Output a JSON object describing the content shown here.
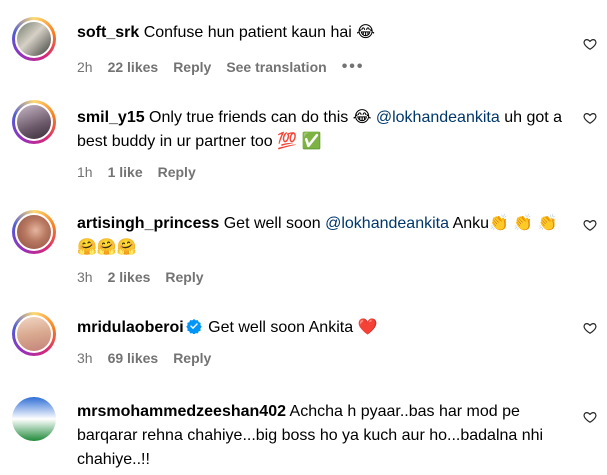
{
  "comments": [
    {
      "username": "soft_srk",
      "text": " Confuse hun patient kaun hai 😂",
      "time": "2h",
      "likes": "22 likes",
      "reply": "Reply",
      "translation": "See translation",
      "more": "•••"
    },
    {
      "username": "smil_y15",
      "text": " Only true friends can do this 😂 ",
      "mention": "@lokhandeankita",
      "text_after": " uh got a best buddy in ur partner too 💯 ✅",
      "time": "1h",
      "likes": "1 like",
      "reply": "Reply"
    },
    {
      "username": "artisingh_princess",
      "text": " Get well soon ",
      "mention": "@lokhandeankita",
      "text_after": " Anku👏 👏 👏🤗🤗🤗",
      "time": "3h",
      "likes": "2 likes",
      "reply": "Reply"
    },
    {
      "username": "mridulaoberoi",
      "text": " Get well soon Ankita ❤️",
      "time": "3h",
      "likes": "69 likes",
      "reply": "Reply"
    },
    {
      "username": "mrsmohammedzeeshan402",
      "text": " Achcha h pyaar..bas har mod pe barqarar rehna chahiye...big boss ho ya kuch aur ho...badalna nhi chahiye..!!"
    }
  ],
  "icons": {
    "like": "heart-outline-icon",
    "verified": "verified-badge-icon"
  },
  "colors": {
    "meta_text": "#737373",
    "mention": "#00376b",
    "verified": "#0095f6"
  }
}
